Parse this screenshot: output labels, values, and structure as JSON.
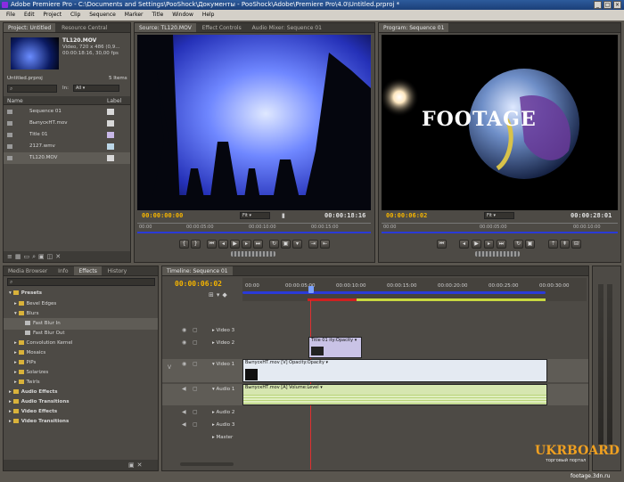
{
  "window": {
    "title": "Adobe Premiere Pro - C:\\Documents and Settings\\PooShock\\Документы - PooShock\\Adobe\\Premiere Pro\\4.0\\Untitled.prproj *"
  },
  "menu": [
    "File",
    "Edit",
    "Project",
    "Clip",
    "Sequence",
    "Marker",
    "Title",
    "Window",
    "Help"
  ],
  "project": {
    "tabs": [
      "Project: Untitled",
      "Resource Central"
    ],
    "clip_name": "TL120.MOV",
    "clip_info1": "Video, 720 x 486 (0,9...",
    "clip_info2": "00:00:18:16, 30,00 fps",
    "project_file": "Untitled.prproj",
    "items_count": "5 Items",
    "in_label": "In:",
    "in_value": "All",
    "col_name": "Name",
    "col_label": "Label",
    "items": [
      {
        "name": "Sequence 01",
        "color": "#d8d8d8"
      },
      {
        "name": "ВыпускНТ.mov",
        "color": "#d8d8d8"
      },
      {
        "name": "Title 01",
        "color": "#c8b8e8"
      },
      {
        "name": "2127.wmv",
        "color": "#bcd7e8"
      },
      {
        "name": "TL120.MOV",
        "color": "#d8d8d8"
      }
    ]
  },
  "source": {
    "tabs": [
      "Source: TL120.MOV",
      "Effect Controls",
      "Audio Mixer: Sequence 01"
    ],
    "tc_current": "00:00:00:00",
    "fit": "Fit",
    "tc_duration": "00:00:18:16",
    "ruler": [
      "00:00",
      "00:00:05:00",
      "00:00:10:00",
      "00:00:15:00"
    ]
  },
  "program": {
    "tabs": [
      "Program: Sequence 01"
    ],
    "overlay_text": "FOOTAGE",
    "tc_current": "00:00:06:02",
    "fit": "Fit",
    "tc_duration": "00:00:28:01",
    "ruler": [
      "00:00",
      "00:00:05:00",
      "00:00:10:00"
    ]
  },
  "effects": {
    "tabs": [
      "Media Browser",
      "Info",
      "Effects",
      "History"
    ],
    "tree": [
      {
        "label": "Presets",
        "bold": true
      },
      {
        "label": "Bevel Edges",
        "bold": false
      },
      {
        "label": "Blurs",
        "bold": false
      },
      {
        "label": "Fast Blur In",
        "bold": false
      },
      {
        "label": "Fast Blur Out",
        "bold": false
      },
      {
        "label": "Convolution Kernel",
        "bold": false
      },
      {
        "label": "Mosaics",
        "bold": false
      },
      {
        "label": "PiPs",
        "bold": false
      },
      {
        "label": "Solarizes",
        "bold": false
      },
      {
        "label": "Twirls",
        "bold": false
      },
      {
        "label": "Audio Effects",
        "bold": true
      },
      {
        "label": "Audio Transitions",
        "bold": true
      },
      {
        "label": "Video Effects",
        "bold": true
      },
      {
        "label": "Video Transitions",
        "bold": true
      }
    ]
  },
  "timeline": {
    "tab": "Timeline: Sequence 01",
    "tc_current": "00:00:06:02",
    "ruler": [
      "00:00",
      "00:00:05:00",
      "00:00:10:00",
      "00:00:15:00",
      "00:00:20:00",
      "00:00:25:00",
      "00:00:30:00"
    ],
    "tracks": [
      "Video 3",
      "Video 2",
      "Video 1",
      "Audio 1",
      "Audio 2",
      "Audio 3",
      "Master"
    ],
    "clips": {
      "title_clip": "Title 01",
      "title_fx": "ity:Opacity",
      "video_clip": "ВыпускНТ.mov [V]",
      "video_fx": "Opacity:Opacity",
      "audio_clip": "ВыпускНТ.mov [A]",
      "audio_fx": "Volume:Level"
    }
  },
  "watermark": {
    "brand": "UKRBOARD",
    "slogan": "торговый портал",
    "url": "footage.3dn.ru"
  }
}
